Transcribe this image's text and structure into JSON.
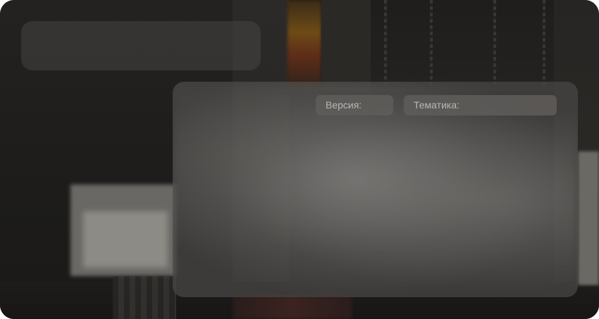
{
  "window": {
    "corner_style": "rounded"
  },
  "card": {
    "title": "",
    "meta": {
      "version_label": "Версия:",
      "theme_label": "Тематика:"
    }
  },
  "colors": {
    "panel": "#4a4846",
    "pill": "#5f5d5b",
    "pill_text": "#b8b6b3",
    "background": "#1b1a19"
  }
}
